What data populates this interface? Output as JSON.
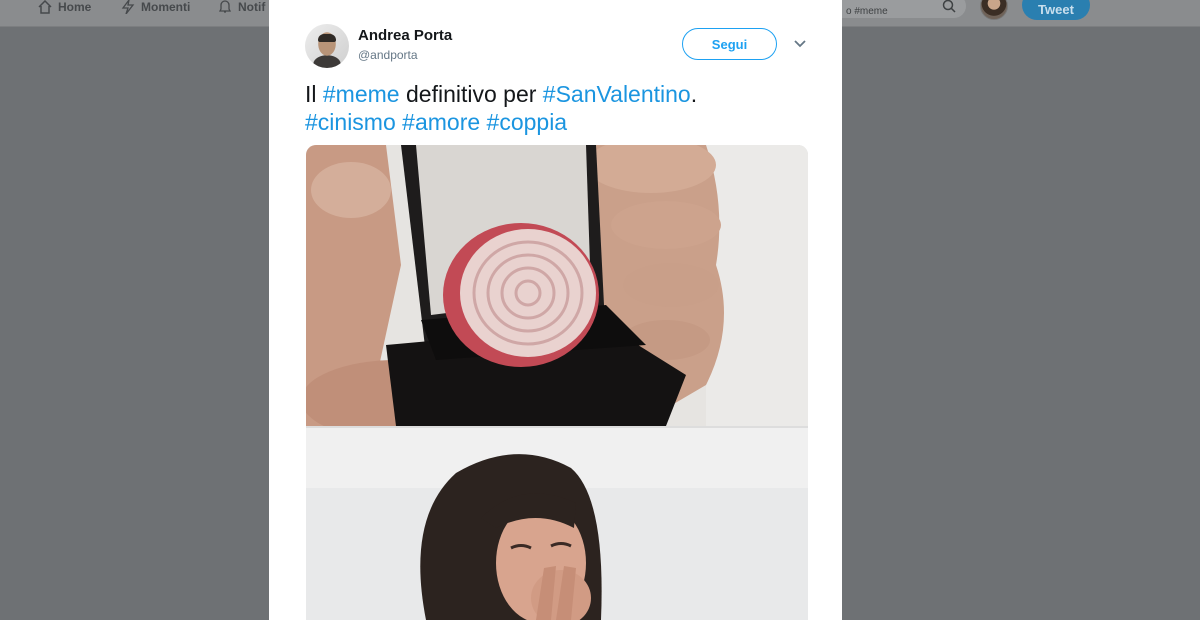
{
  "nav": {
    "home_label": "Home",
    "moments_label": "Momenti",
    "notifications_label": "Notif",
    "search_value": "o #meme",
    "tweet_button_label": "Tweet"
  },
  "tweet": {
    "author": {
      "display_name": "Andrea Porta",
      "username": "@andporta"
    },
    "follow_label": "Segui",
    "text_parts": {
      "p1": "Il ",
      "tag1": "#meme",
      "p2": " definitivo per ",
      "tag2": "#SanValentino",
      "p3": ".",
      "tag3": "#cinismo",
      "tag4": "#amore",
      "tag5": "#coppia"
    }
  },
  "colors": {
    "accent": "#1da1f2",
    "hashtag": "#1b95e0",
    "overlay": "#6e7174"
  },
  "icons": [
    "home-icon",
    "lightning-icon",
    "bell-icon",
    "search-icon",
    "chevron-down-icon"
  ]
}
